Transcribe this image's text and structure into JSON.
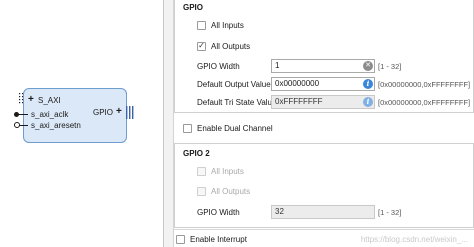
{
  "ip_block": {
    "ports_left": [
      {
        "name": "S_AXI",
        "kind": "bus"
      },
      {
        "name": "s_axi_aclk",
        "kind": "clock"
      },
      {
        "name": "s_axi_aresetn",
        "kind": "reset"
      }
    ],
    "port_right": {
      "name": "GPIO",
      "kind": "bus"
    },
    "fill_color": "#dbe8f7",
    "border_color": "#6d9ccf"
  },
  "gpio": {
    "title": "GPIO",
    "all_inputs": {
      "label": "All Inputs",
      "checked": false,
      "enabled": true
    },
    "all_outputs": {
      "label": "All Outputs",
      "checked": true,
      "enabled": true
    },
    "width": {
      "label": "GPIO Width",
      "value": "1",
      "range": "[1 - 32]"
    },
    "default_output": {
      "label": "Default Output Value",
      "value": "0x00000000",
      "range": "[0x00000000,0xFFFFFFFF]"
    },
    "default_tri": {
      "label": "Default Tri State Value",
      "value": "0xFFFFFFFF",
      "range": "[0x00000000,0xFFFFFFFF]"
    }
  },
  "dual_channel": {
    "label": "Enable Dual Channel",
    "checked": false
  },
  "gpio2": {
    "title": "GPIO 2",
    "all_inputs": {
      "label": "All Inputs",
      "checked": false,
      "enabled": false
    },
    "all_outputs": {
      "label": "All Outputs",
      "checked": false,
      "enabled": false
    },
    "width": {
      "label": "GPIO Width",
      "value": "32",
      "range": "[1 - 32]"
    }
  },
  "interrupt": {
    "label": "Enable Interrupt",
    "checked": false
  },
  "watermark": "https://blog.csdn.net/weixin_..."
}
